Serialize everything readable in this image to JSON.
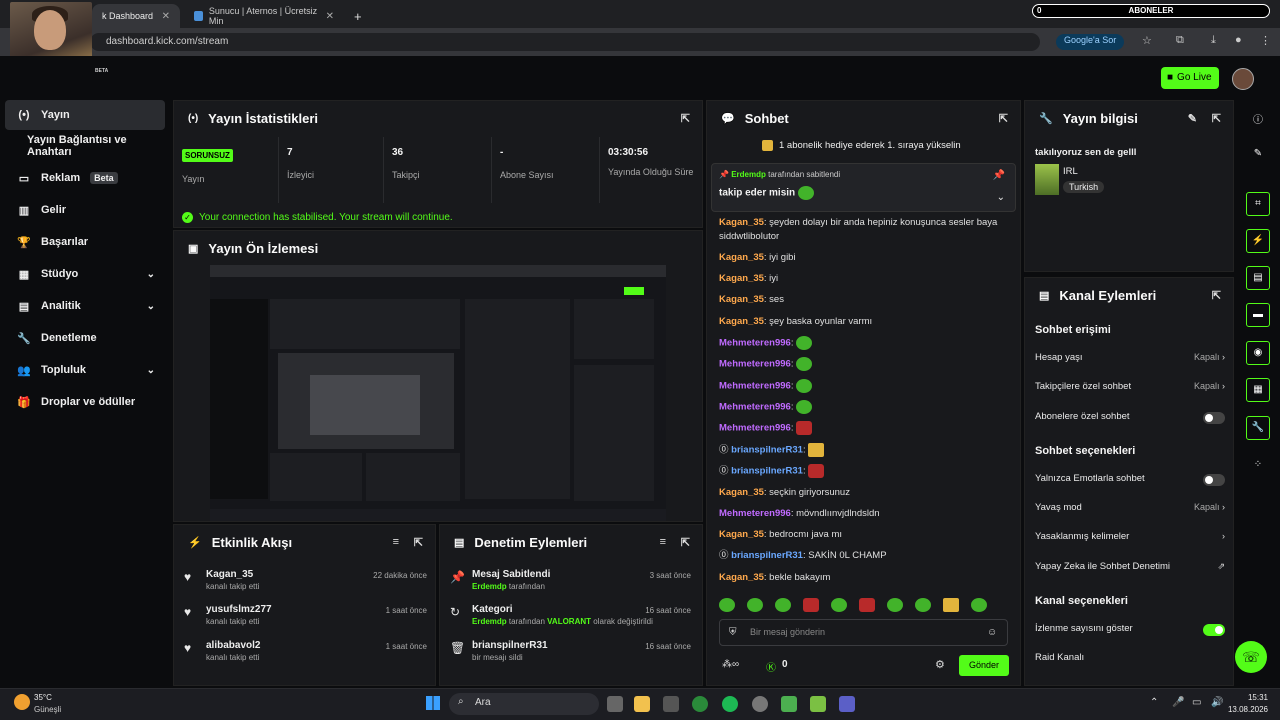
{
  "browser": {
    "tabs": [
      {
        "label": "k Dashboard"
      },
      {
        "label": "Sunucu | Aternos | Ücretsiz Min"
      }
    ],
    "url": "dashboard.kick.com/stream",
    "google_sor": "Google'a Sor"
  },
  "overlay": {
    "sub_label": "ABONELER",
    "sub_count": "0",
    "beta_tag": "BETA"
  },
  "header": {
    "go_live": "Go Live"
  },
  "sidebar": {
    "items": [
      {
        "label": "Yayın"
      },
      {
        "label": "Yayın Bağlantısı ve Anahtarı"
      },
      {
        "label": "Reklam",
        "badge": "Beta"
      },
      {
        "label": "Gelir"
      },
      {
        "label": "Başarılar"
      },
      {
        "label": "Stüdyo"
      },
      {
        "label": "Analitik"
      },
      {
        "label": "Denetleme"
      },
      {
        "label": "Topluluk"
      },
      {
        "label": "Droplar ve ödüller"
      }
    ]
  },
  "stats": {
    "title": "Yayın İstatistikleri",
    "status": "SORUNSUZ",
    "status_label": "Yayın",
    "items": [
      {
        "value": "7",
        "label": "İzleyici"
      },
      {
        "value": "36",
        "label": "Takipçi"
      },
      {
        "value": "-",
        "label": "Abone Sayısı"
      },
      {
        "value": "03:30:56",
        "label": "Yayında Olduğu Süre"
      }
    ],
    "notice": "Your connection has stabilised. Your stream will continue."
  },
  "preview": {
    "title": "Yayın Ön İzlemesi"
  },
  "activity": {
    "title": "Etkinlik Akışı",
    "items": [
      {
        "name": "Kagan_35",
        "desc": "kanalı takip etti",
        "time": "22 dakika önce"
      },
      {
        "name": "yusufslmz277",
        "desc": "kanalı takip etti",
        "time": "1 saat önce"
      },
      {
        "name": "alibabavol2",
        "desc": "kanalı takip etti",
        "time": "1 saat önce"
      }
    ]
  },
  "moderation": {
    "title": "Denetim Eylemleri",
    "items": [
      {
        "name": "Mesaj Sabitlendi",
        "actor": "Erdemdp",
        "desc": "tarafından",
        "extra": "",
        "extra2": "",
        "time": "3 saat önce"
      },
      {
        "name": "Kategori",
        "actor": "Erdemdp",
        "desc": "tarafından",
        "extra": "VALORANT",
        "extra2": "olarak değiştirildi",
        "time": "16 saat önce"
      },
      {
        "name": "brianspilnerR31",
        "actor": "",
        "desc": "bir mesajı sildi",
        "extra": "",
        "extra2": "",
        "time": "16 saat önce"
      }
    ]
  },
  "chat": {
    "title": "Sohbet",
    "gift_banner": "1 abonelik hediye ederek 1. sıraya yükselin",
    "pinned_by": "Erdemdp",
    "pinned_by_suffix": "tarafından sabitlendi",
    "pinned_text": "takip eder misin",
    "messages": [
      {
        "user": "Kagan_35",
        "text": "şeyden dolayı bir anda hepiniz konuşunca sesler baya siddwtlibolutor",
        "color": "org"
      },
      {
        "user": "Kagan_35",
        "text": "iyi gibi",
        "color": "org"
      },
      {
        "user": "Kagan_35",
        "text": "iyi",
        "color": "org"
      },
      {
        "user": "Kagan_35",
        "text": "ses",
        "color": "org"
      },
      {
        "user": "Kagan_35",
        "text": "şey baska oyunlar varmı",
        "color": "org"
      },
      {
        "user": "Mehmeteren996",
        "text": "",
        "color": "pur"
      },
      {
        "user": "Mehmeteren996",
        "text": "",
        "color": "pur"
      },
      {
        "user": "Mehmeteren996",
        "text": "",
        "color": "pur"
      },
      {
        "user": "Mehmeteren996",
        "text": "",
        "color": "pur"
      },
      {
        "user": "Mehmeteren996",
        "text": "",
        "color": "pur"
      },
      {
        "user": "brianspilnerR31",
        "text": "",
        "color": "blu"
      },
      {
        "user": "brianspilnerR31",
        "text": "",
        "color": "blu"
      },
      {
        "user": "Kagan_35",
        "text": "seçkin giriyorsunuz",
        "color": "org"
      },
      {
        "user": "Mehmeteren996",
        "text": "mövndlıınvjdlndsldn",
        "color": "pur"
      },
      {
        "user": "Kagan_35",
        "text": "bedrocmı java mı",
        "color": "org"
      },
      {
        "user": "brianspilnerR31",
        "text": "SAKİN 0L CHAMP",
        "color": "blu"
      },
      {
        "user": "Kagan_35",
        "text": "bekle bakayım",
        "color": "org"
      }
    ],
    "input_placeholder": "Bir mesaj gönderin",
    "points": "0",
    "send": "Gönder"
  },
  "stream_info": {
    "title": "Yayın bilgisi",
    "stream_title": "takılıyoruz sen de gelll",
    "category": "IRL",
    "language": "Turkish"
  },
  "channel_actions": {
    "title": "Kanal Eylemleri",
    "chat_access": "Sohbet erişimi",
    "account_age": {
      "label": "Hesap yaşı",
      "value": "Kapalı"
    },
    "followers_only": {
      "label": "Takipçilere özel sohbet",
      "value": "Kapalı"
    },
    "subs_only": {
      "label": "Abonelere özel sohbet"
    },
    "chat_options": "Sohbet seçenekleri",
    "emotes_only": {
      "label": "Yalnızca Emotlarla sohbet"
    },
    "slow_mode": {
      "label": "Yavaş mod",
      "value": "Kapalı"
    },
    "banned_words": {
      "label": "Yasaklanmış kelimeler"
    },
    "ai_mod": {
      "label": "Yapay Zeka ile Sohbet Denetimi"
    },
    "channel_options": "Kanal seçenekleri",
    "show_viewers": {
      "label": "İzlenme sayısını göster"
    },
    "raid": {
      "label": "Raid Kanalı"
    }
  },
  "taskbar": {
    "weather_temp": "35°C",
    "weather_desc": "Güneşli",
    "search": "Ara",
    "time": "15:31",
    "date": "13.08.2026"
  }
}
